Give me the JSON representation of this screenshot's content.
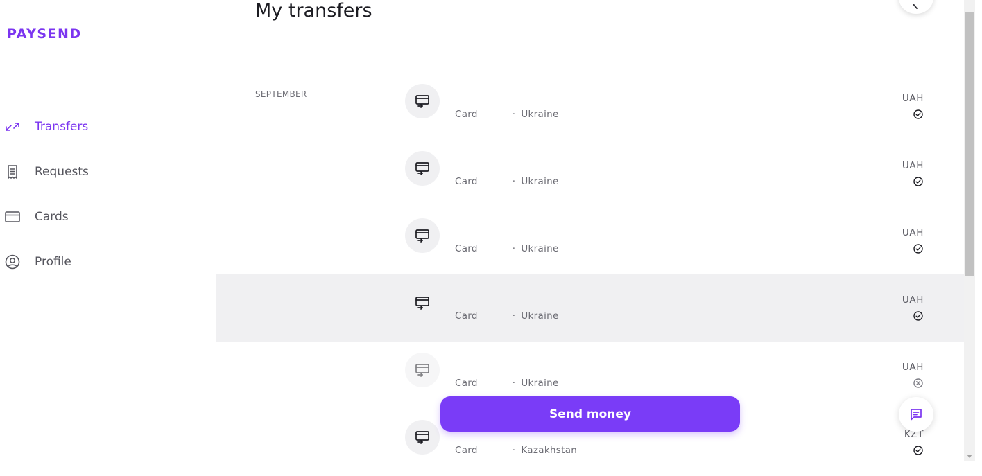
{
  "brand": {
    "logo": "PAYSEND"
  },
  "nav": {
    "items": [
      {
        "label": "Transfers",
        "icon": "transfer-arrows-icon",
        "active": true
      },
      {
        "label": "Requests",
        "icon": "receipt-icon",
        "active": false
      },
      {
        "label": "Cards",
        "icon": "card-icon",
        "active": false
      },
      {
        "label": "Profile",
        "icon": "profile-icon",
        "active": false
      }
    ]
  },
  "page": {
    "title": "My transfers"
  },
  "month": "SEPTEMBER",
  "transfers": [
    {
      "method": "Card",
      "country": "Ukraine",
      "currency": "UAH",
      "status": "completed"
    },
    {
      "method": "Card",
      "country": "Ukraine",
      "currency": "UAH",
      "status": "completed"
    },
    {
      "method": "Card",
      "country": "Ukraine",
      "currency": "UAH",
      "status": "completed"
    },
    {
      "method": "Card",
      "country": "Ukraine",
      "currency": "UAH",
      "status": "completed"
    },
    {
      "method": "Card",
      "country": "Ukraine",
      "currency": "UAH",
      "status": "cancelled"
    },
    {
      "method": "Card",
      "country": "Kazakhstan",
      "currency": "KZT",
      "status": "completed"
    }
  ],
  "actions": {
    "send_money": "Send money"
  },
  "colors": {
    "accent": "#7b35f0",
    "button": "#7a3cf7",
    "highlight_row": "#f0f0f2"
  }
}
